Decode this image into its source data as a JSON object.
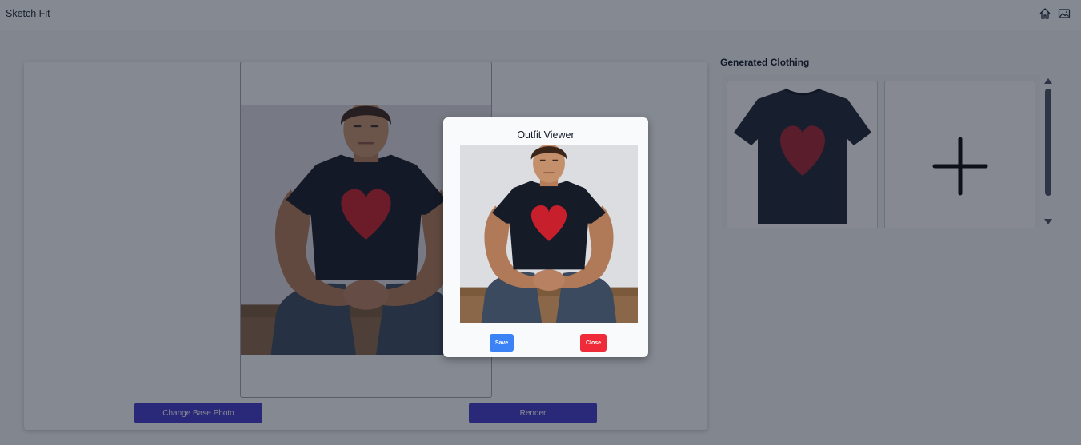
{
  "app": {
    "title": "Sketch Fit"
  },
  "header": {
    "icons": [
      {
        "name": "home-icon"
      },
      {
        "name": "gallery-icon"
      }
    ]
  },
  "workspace": {
    "change_photo_label": "Change Base Photo",
    "render_label": "Render"
  },
  "clothing_panel": {
    "title": "Generated Clothing",
    "items": [
      {
        "type": "tshirt",
        "color": "#1c2433",
        "graphic": "heart",
        "graphic_color": "#a3232e"
      },
      {
        "type": "add-new"
      }
    ]
  },
  "modal": {
    "title": "Outfit Viewer",
    "save_label": "Save",
    "close_label": "Close"
  },
  "colors": {
    "accent": "#4338ca",
    "save": "#3b82f6",
    "close": "#ef2b3a",
    "shirt": "#161b28",
    "heart": "#c71f2b"
  }
}
